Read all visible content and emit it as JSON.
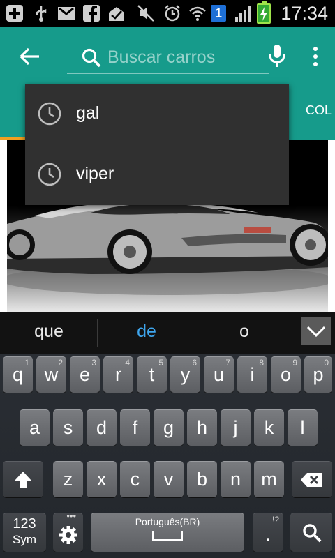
{
  "status_bar": {
    "time": "17:34",
    "notification_count": "1",
    "icons": [
      "add-icon",
      "usb-icon",
      "gmail-icon",
      "facebook-icon",
      "inbox-icon",
      "mute-icon",
      "alarm-icon",
      "wifi-icon",
      "notification-badge",
      "signal-icon",
      "battery-charging-icon"
    ]
  },
  "app_bar": {
    "search_placeholder": "Buscar carros",
    "tab_peek_label": "COL",
    "color": "#169b8b",
    "accent_color": "#f0a020"
  },
  "suggestions": [
    {
      "label": "gal",
      "icon": "history-icon"
    },
    {
      "label": "viper",
      "icon": "history-icon"
    }
  ],
  "keyboard": {
    "suggestion_strip": [
      "que",
      "de",
      "o"
    ],
    "highlight_color": "#3ea6ee",
    "rows": [
      [
        {
          "k": "q",
          "n": "1"
        },
        {
          "k": "w",
          "n": "2"
        },
        {
          "k": "e",
          "n": "3"
        },
        {
          "k": "r",
          "n": "4"
        },
        {
          "k": "t",
          "n": "5"
        },
        {
          "k": "y",
          "n": "6"
        },
        {
          "k": "u",
          "n": "7"
        },
        {
          "k": "i",
          "n": "8"
        },
        {
          "k": "o",
          "n": "9"
        },
        {
          "k": "p",
          "n": "0"
        }
      ],
      [
        {
          "k": "a"
        },
        {
          "k": "s"
        },
        {
          "k": "d"
        },
        {
          "k": "f"
        },
        {
          "k": "g"
        },
        {
          "k": "h"
        },
        {
          "k": "j"
        },
        {
          "k": "k"
        },
        {
          "k": "l"
        }
      ],
      [
        {
          "k": "z"
        },
        {
          "k": "x"
        },
        {
          "k": "c"
        },
        {
          "k": "v"
        },
        {
          "k": "b"
        },
        {
          "k": "n"
        },
        {
          "k": "m"
        }
      ]
    ],
    "sym_label_top": "123",
    "sym_label_bottom": "Sym",
    "space_label": "Português(BR)",
    "period_label": ".",
    "period_hint": "!?",
    "settings_hint": "•••"
  }
}
